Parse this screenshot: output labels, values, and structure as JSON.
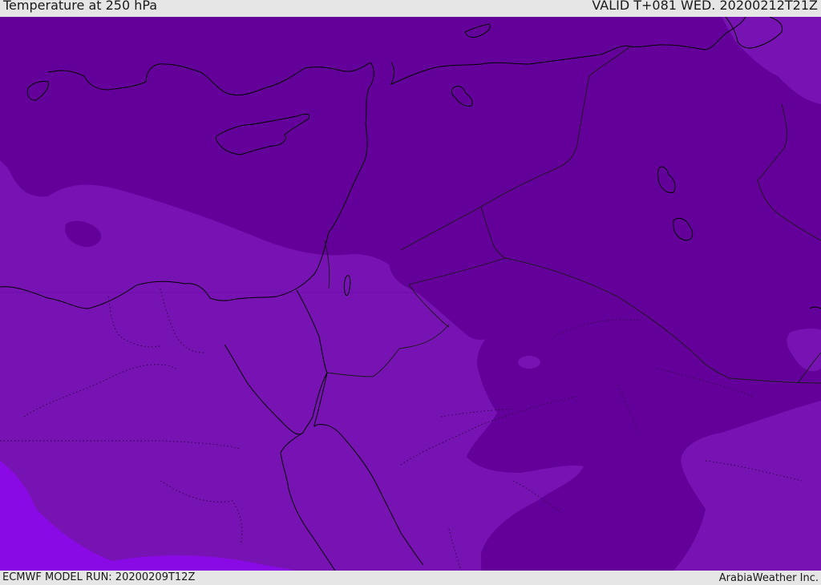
{
  "header": {
    "title": "Temperature at 250 hPa",
    "valid_time": "VALID T+081 WED. 20200212T21Z"
  },
  "footer": {
    "model_run": "ECMWF MODEL RUN: 20200209T12Z",
    "credit": "ArabiaWeather Inc."
  },
  "map": {
    "region": "Eastern Mediterranean / Middle East",
    "colors": {
      "cold_dark_purple": "#64009a",
      "mid_purple": "#7712b3",
      "warm_violet": "#8a0ae6",
      "coastline": "#000000",
      "borders": "#1a1a1a"
    }
  }
}
